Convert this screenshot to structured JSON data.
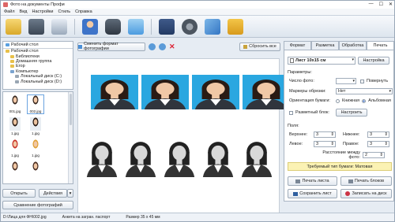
{
  "window": {
    "title": "Фото на документы Профи",
    "min": "—",
    "max": "☐",
    "close": "✕"
  },
  "menu": [
    "Файл",
    "Вид",
    "Настройки",
    "Стиль",
    "Справка"
  ],
  "toolbar_icons": [
    "open-folder-icon",
    "save-icon",
    "print-icon",
    "user-icon",
    "camera-icon",
    "photo-edit-icon",
    "help-book-icon",
    "video-icon",
    "tools-icon",
    "shopping-cart-icon"
  ],
  "tree": {
    "combo": "Рабочий стол",
    "nodes": [
      "Рабочий стол",
      "Библиотеки",
      "Домашняя группа",
      "Егор",
      "Компьютер",
      "Локальный диск (C:)",
      "Локальный диск (D:)"
    ]
  },
  "thumbs": [
    "001.jpg",
    "002.jpg",
    "1.jpg",
    "1.jpg",
    "1.jpg",
    "1.jpg",
    "",
    "",
    ""
  ],
  "left_buttons": {
    "open": "Открыть",
    "actions": "Действия",
    "compare": "Сравнение фотографий"
  },
  "center_toolbar": {
    "change_format": "Сменить формат фотографии",
    "reset_all": "Сбросить все"
  },
  "right": {
    "tabs": [
      "Формат",
      "Разметка",
      "Обработка",
      "Печать"
    ],
    "paper_label": "Лист 10х15 см",
    "settings_button": "Настройка",
    "params_label": "Параметры:",
    "photo_count_label": "Число фото:",
    "photo_count_value": "",
    "rotate_label": "Повернуть",
    "cut_markers_label": "Маркеры обрезки:",
    "cut_markers_value": "Нет",
    "orientation_label": "Ориентация бумаги:",
    "portrait": "Книжная",
    "landscape": "Альбомная",
    "split_label": "Разметный блок:",
    "configure_button": "Настроить",
    "fields_label": "Поля:",
    "top_label": "Верхнее:",
    "top_value": "3",
    "bottom_label": "Нижнее:",
    "bottom_value": "3",
    "left_label": "Левое:",
    "left_value": "3",
    "right_label": "Правое:",
    "right_value": "3",
    "spacing_label": "Расстояние между фото:",
    "spacing_value": "2",
    "paper_type_banner": "Требуемый тип бумаги: Матовая",
    "print_sheet": "Печать листа",
    "print_blocks": "Печать блоков",
    "save_sheet": "Сохранить лист",
    "write_disk": "Записать на диск"
  },
  "status": {
    "path": "D:\\Лица для ФН\\002.jpg",
    "doc": "Анкета на загран. паспорт",
    "size": "Размер 35 х 45 мм"
  },
  "colors": {
    "accent": "#2a62c9",
    "banner": "#fbf2b4",
    "photo_bg": "#2aa7e0"
  }
}
